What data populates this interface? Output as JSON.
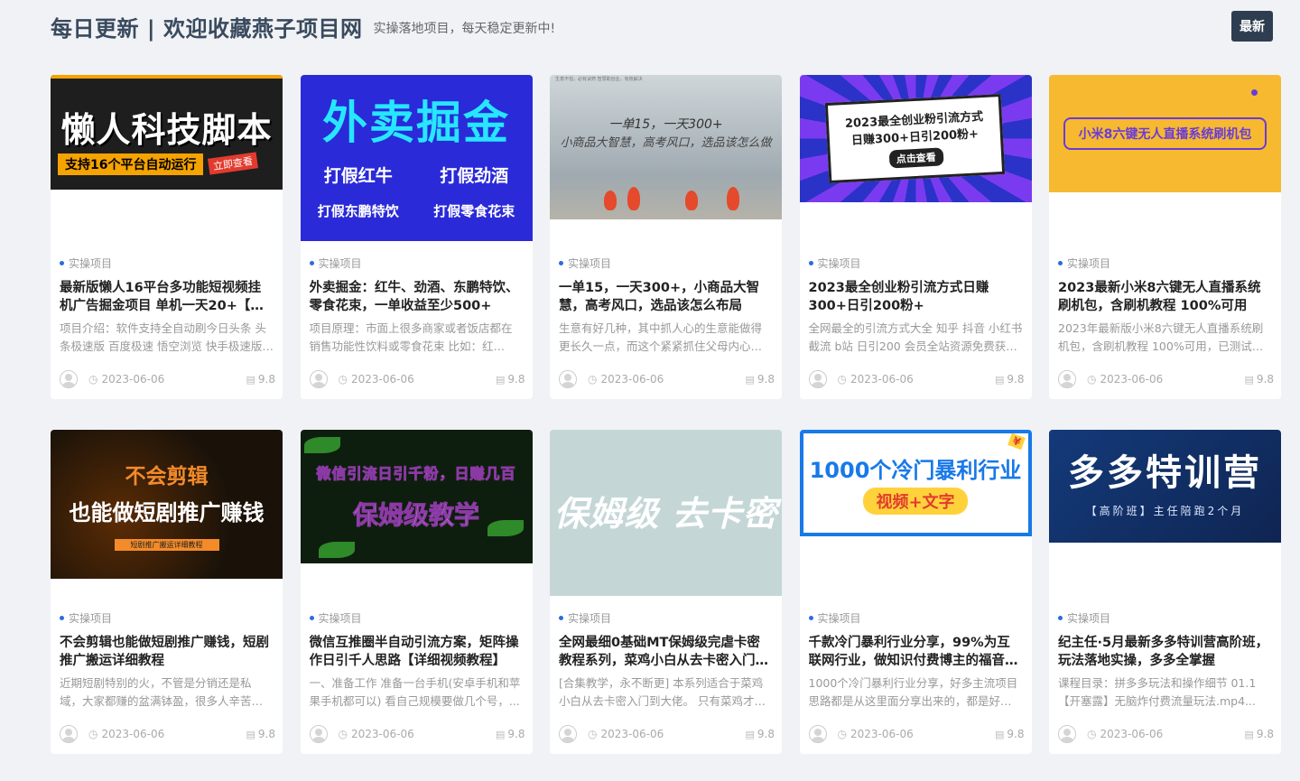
{
  "header": {
    "title": "每日更新 | 欢迎收藏燕子项目网",
    "subtitle": "实操落地项目，每天稳定更新中!",
    "latest_label": "最新"
  },
  "icons": {
    "clock": "clock-icon",
    "views": "views-icon",
    "avatar": "user-avatar-icon"
  },
  "cards": [
    {
      "thumb": {
        "line1": "懒人科技脚本",
        "line2": "支持16个平台自动运行",
        "line3": "立即查看"
      },
      "category": "实操项目",
      "title": "最新版懒人16平台多功能短视频挂机广告掘金项目 单机一天20+【脚本...",
      "desc": "项目介绍：软件支持全自动刷今日头条 头条极速版 百度极速 悟空浏览 快手极速版 ...",
      "date": "2023-06-06",
      "views": "9.8"
    },
    {
      "thumb": {
        "line1": "外卖掘金",
        "line2a": "打假红牛",
        "line2b": "打假劲酒",
        "line3a": "打假东鹏特饮",
        "line3b": "打假零食花束"
      },
      "category": "实操项目",
      "title": "外卖掘金：红牛、劲酒、东鹏特饮、零食花束，一单收益至少500+",
      "desc": "项目原理：市面上很多商家或者饭店都在销售功能性饮料或零食花束 比如：红牛、...",
      "date": "2023-06-06",
      "views": "9.8"
    },
    {
      "thumb": {
        "line1": "一单15，一天300+",
        "line2": "小商品大智慧，高考风口，选品该怎么做",
        "note": "生意不怕，必有诀窍 智慧助创业，有效解决"
      },
      "category": "实操项目",
      "title": "一单15，一天300+，小商品大智慧，高考风口，选品该怎么布局",
      "desc": "生意有好几种，其中抓人心的生意能做得更长久一点，而这个紧紧抓住父母内心的产...",
      "date": "2023-06-06",
      "views": "9.8"
    },
    {
      "thumb": {
        "line1": "2023最全创业粉引流方式",
        "line2": "日赚300+日引200粉+",
        "line3": "点击查看"
      },
      "category": "实操项目",
      "title": "2023最全创业粉引流方式日赚300+日引200粉+",
      "desc": "全网最全的引流方式大全 知乎 抖音 小红书 截流 b站 日引200 会员全站资源免费获取...",
      "date": "2023-06-06",
      "views": "9.8"
    },
    {
      "thumb": {
        "line1": "小米8六键无人直播系统刷机包"
      },
      "category": "实操项目",
      "title": "2023最新小米8六键无人直播系统刷机包，含刷机教程 100%可用",
      "desc": "2023年最新版小米8六键无人直播系统刷机包，含刷机教程 100%可用，已测试。 会...",
      "date": "2023-06-06",
      "views": "9.8"
    },
    {
      "thumb": {
        "line1": "不会剪辑",
        "line2": "也能做短剧推广赚钱",
        "line3": "短剧推广搬运详细教程"
      },
      "category": "实操项目",
      "title": "不会剪辑也能做短剧推广赚钱，短剧推广搬运详细教程",
      "desc": "近期短剧特别的火，不管是分销还是私域，大家都赚的盆满钵盈，很多人辛苦剪辑，...",
      "date": "2023-06-06",
      "views": "9.8"
    },
    {
      "thumb": {
        "line1": "微信引流日引千粉，日赚几百",
        "line2": "保姆级教学"
      },
      "category": "实操项目",
      "title": "微信互推圈半自动引流方案，矩阵操作日引千人思路【详细视频教程】",
      "desc": "一、准备工作 准备一台手机(安卓手机和苹果手机都可以) 看自己规模要做几个号，...",
      "date": "2023-06-06",
      "views": "9.8"
    },
    {
      "thumb": {
        "line1": "保姆级 去卡密"
      },
      "category": "实操项目",
      "title": "全网最细0基础MT保姆级完虐卡密教程系列，菜鸡小白从去卡密入门到...",
      "desc": "[合集教学，永不断更] 本系列适合于菜鸡小白从去卡密入门到大佬。 只有菜鸡才有资...",
      "date": "2023-06-06",
      "views": "9.8"
    },
    {
      "thumb": {
        "line1": "1000个冷门暴利行业",
        "line2": "视频+文字",
        "corner": "¥"
      },
      "category": "实操项目",
      "title": "千款冷门暴利行业分享，99%为互联网行业，做知识付费博主的福音材...",
      "desc": "1000个冷门暴利行业分享，好多主流项目思路都是从这里面分享出来的，都是好项目...",
      "date": "2023-06-06",
      "views": "9.8"
    },
    {
      "thumb": {
        "line1": "多多特训营",
        "line2": "【高阶班】主任陪跑2个月"
      },
      "category": "实操项目",
      "title": "纪主任·5月最新多多特训营高阶班，玩法落地实操，多多全掌握",
      "desc": "课程目录：拼多多玩法和操作细节 01.1【开塞露】无脑炸付费流量玩法.mp4...",
      "date": "2023-06-06",
      "views": "9.8"
    }
  ]
}
